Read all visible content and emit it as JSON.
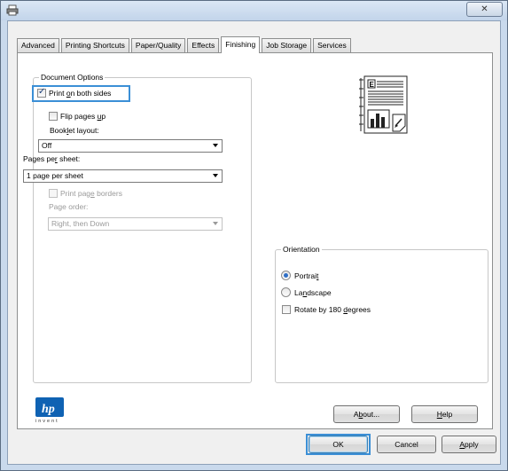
{
  "window": {
    "close_glyph": "✕"
  },
  "tabs": [
    {
      "label": "Advanced"
    },
    {
      "label": "Printing Shortcuts"
    },
    {
      "label": "Paper/Quality"
    },
    {
      "label": "Effects"
    },
    {
      "label": "Finishing"
    },
    {
      "label": "Job Storage"
    },
    {
      "label": "Services"
    }
  ],
  "active_tab": "Finishing",
  "document_options": {
    "group_label": "Document Options",
    "print_both_sides": {
      "pre": "Print ",
      "mnemonic": "o",
      "post": "n both sides",
      "checked": true
    },
    "flip_pages_up": {
      "pre": "Flip pages ",
      "mnemonic": "u",
      "post": "p",
      "checked": false
    },
    "booklet_layout_label": {
      "pre": "Book",
      "mnemonic": "l",
      "post": "et layout:"
    },
    "booklet_layout_value": "Off",
    "pages_per_sheet_label": {
      "pre": "Pages pe",
      "mnemonic": "r",
      "post": " sheet:"
    },
    "pages_per_sheet_value": "1 page per sheet",
    "print_page_borders": {
      "pre": "Print pag",
      "mnemonic": "e",
      "post": " borders",
      "checked": false,
      "disabled": true
    },
    "page_order_label": "Page order:",
    "page_order_value": "Right, then Down"
  },
  "orientation": {
    "group_label": "Orientation",
    "portrait": {
      "pre": "Portrai",
      "mnemonic": "t",
      "post": "",
      "selected": true
    },
    "landscape": {
      "pre": "La",
      "mnemonic": "n",
      "post": "dscape",
      "selected": false
    },
    "rotate": {
      "pre": "Rotate by 180 ",
      "mnemonic": "d",
      "post": "egrees",
      "checked": false
    }
  },
  "logo": {
    "text": "invent",
    "icon": "hp-logo"
  },
  "buttons": {
    "about": {
      "pre": "A",
      "mnemonic": "b",
      "post": "out..."
    },
    "help": {
      "pre": "",
      "mnemonic": "H",
      "post": "elp"
    },
    "ok": "OK",
    "cancel": "Cancel",
    "apply": {
      "pre": "",
      "mnemonic": "A",
      "post": "pply"
    }
  },
  "colors": {
    "accent": "#3b8fd6",
    "hp_blue": "#0f62b3"
  }
}
